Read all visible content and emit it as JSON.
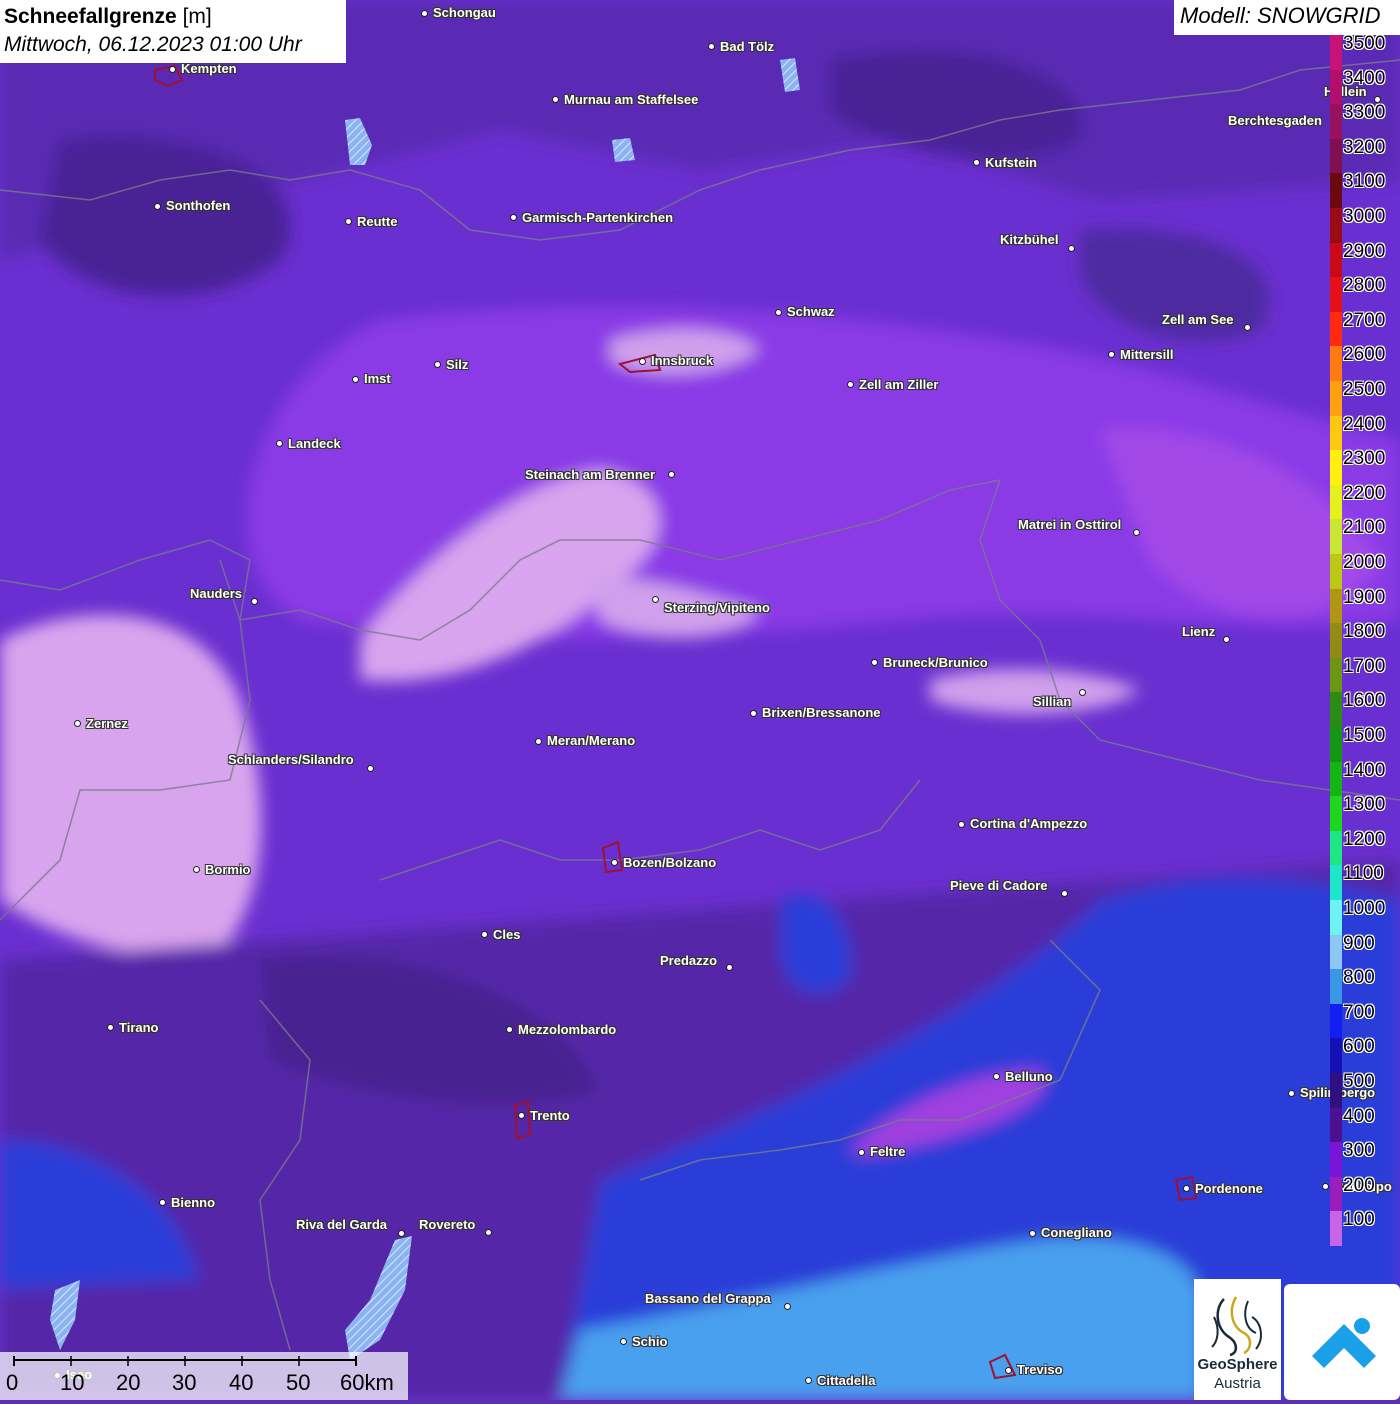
{
  "title": {
    "variable": "Schneefallgrenze",
    "unit": "[m]",
    "datetime": "Mittwoch, 06.12.2023 01:00 Uhr"
  },
  "model": "Modell: SNOWGRID",
  "legend": {
    "labels": [
      "3500",
      "3400",
      "3300",
      "3200",
      "3100",
      "3000",
      "2900",
      "2800",
      "2700",
      "2600",
      "2500",
      "2400",
      "2300",
      "2200",
      "2100",
      "2000",
      "1900",
      "1800",
      "1700",
      "1600",
      "1500",
      "1400",
      "1300",
      "1200",
      "1100",
      "1000",
      "900",
      "800",
      "700",
      "600",
      "500",
      "400",
      "300",
      "200",
      "100"
    ],
    "colors": [
      "#c8127a",
      "#b0106c",
      "#98105e",
      "#801050",
      "#6a0a10",
      "#9a0a14",
      "#c80a18",
      "#e4101c",
      "#ff2a10",
      "#ff7a10",
      "#ffa010",
      "#ffc810",
      "#fff010",
      "#e2f21a",
      "#c8e632",
      "#bcc814",
      "#b09614",
      "#928c14",
      "#6a9614",
      "#2a8c14",
      "#129614",
      "#14b414",
      "#1ed61e",
      "#1ee682",
      "#1ee6c8",
      "#6ef2f2",
      "#8cc8f2",
      "#3c96e6",
      "#141ef2",
      "#1410b4",
      "#301080",
      "#4c1090",
      "#7a14d6",
      "#9a1ebe",
      "#c864e6"
    ]
  },
  "cities": [
    {
      "name": "Schongau"
    },
    {
      "name": "Bad Tölz"
    },
    {
      "name": "Kempten"
    },
    {
      "name": "Murnau am Staffelsee"
    },
    {
      "name": "Hallein"
    },
    {
      "name": "Berchtesgaden"
    },
    {
      "name": "Kufstein"
    },
    {
      "name": "Sonthofen"
    },
    {
      "name": "Reutte"
    },
    {
      "name": "Garmisch-Partenkirchen"
    },
    {
      "name": "Kitzbühel"
    },
    {
      "name": "Schwaz"
    },
    {
      "name": "Zell am See"
    },
    {
      "name": "Innsbruck"
    },
    {
      "name": "Mittersill"
    },
    {
      "name": "Imst"
    },
    {
      "name": "Silz"
    },
    {
      "name": "Zell am Ziller"
    },
    {
      "name": "Landeck"
    },
    {
      "name": "Steinach am Brenner"
    },
    {
      "name": "Matrei in Osttirol"
    },
    {
      "name": "Nauders"
    },
    {
      "name": "Sterzing/Vipiteno"
    },
    {
      "name": "Lienz"
    },
    {
      "name": "Bruneck/Brunico"
    },
    {
      "name": "Sillian"
    },
    {
      "name": "Zernez"
    },
    {
      "name": "Brixen/Bressanone"
    },
    {
      "name": "Meran/Merano"
    },
    {
      "name": "Schlanders/Silandro"
    },
    {
      "name": "Cortina d'Ampezzo"
    },
    {
      "name": "Bozen/Bolzano"
    },
    {
      "name": "Bormio"
    },
    {
      "name": "Pieve di Cadore"
    },
    {
      "name": "Cles"
    },
    {
      "name": "Predazzo"
    },
    {
      "name": "Tirano"
    },
    {
      "name": "Mezzolombardo"
    },
    {
      "name": "Belluno"
    },
    {
      "name": "Spilimbergo"
    },
    {
      "name": "Trento"
    },
    {
      "name": "Feltre"
    },
    {
      "name": "Pordenone"
    },
    {
      "name": "Codroipo"
    },
    {
      "name": "Bienno"
    },
    {
      "name": "Riva del Garda"
    },
    {
      "name": "Rovereto"
    },
    {
      "name": "Conegliano"
    },
    {
      "name": "Bassano del Grappa"
    },
    {
      "name": "Schio"
    },
    {
      "name": "Iseo"
    },
    {
      "name": "Treviso"
    },
    {
      "name": "Cittadella"
    }
  ],
  "scalebar": {
    "labels": [
      "0",
      "10",
      "20",
      "30",
      "40",
      "50",
      "60km"
    ]
  },
  "logo": {
    "line1": "GeoSphere",
    "line2": "Austria"
  }
}
